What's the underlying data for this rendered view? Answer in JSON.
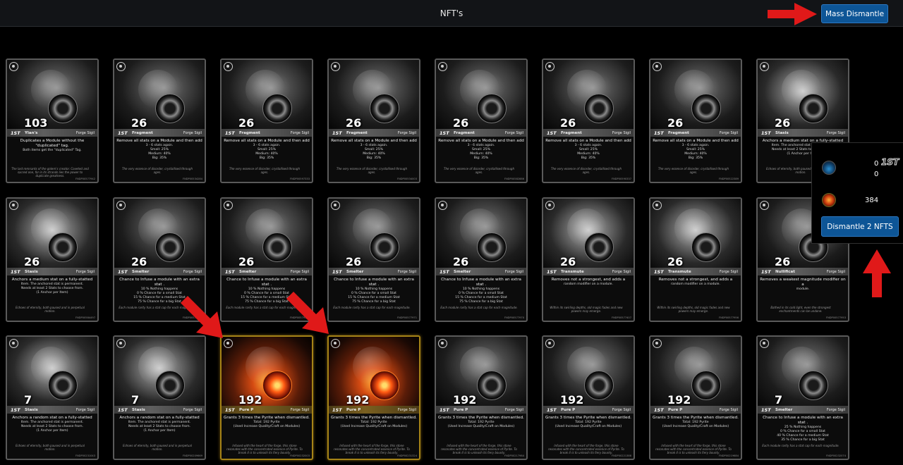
{
  "header": {
    "title": "NFT's",
    "mass_dismantle_label": "Mass Dismantle"
  },
  "side_panel": {
    "st_value": "0",
    "st_tag": "1ST",
    "second_value": "0",
    "pyrite_value": "384",
    "dismantle_label": "Dismantle 2 NFTS"
  },
  "cards": [
    {
      "count": "103",
      "tag": "1ST",
      "name": "Ylan's",
      "kind": "Forge Sigil",
      "art": "gray",
      "selected": false,
      "lines": [
        "Duplicates a Module without the \"duplicated\" tag.",
        "Both items get the \"duplicated\" Tag."
      ],
      "flavor": "The last remnants of the golem's creator. Coveted and sacred one, for in its strands lies the power to duplicate greatness.",
      "serial": "FNDP00577942"
    },
    {
      "count": "26",
      "tag": "1ST",
      "name": "Fragment",
      "kind": "Forge Sigil",
      "art": "gray",
      "selected": false,
      "lines": [
        "Remove all stats on a Module and then add",
        "3 - 6 stats again.",
        "Small: 25%",
        "Medium: 40%",
        "Big: 35%"
      ],
      "flavor": "The very essence of disorder, crystallised through ages.",
      "serial": "FNDP00534284"
    },
    {
      "count": "26",
      "tag": "1ST",
      "name": "Fragment",
      "kind": "Forge Sigil",
      "art": "gray",
      "selected": false,
      "lines": [
        "Remove all stats on a Module and then add",
        "3 - 6 stats again.",
        "Small: 25%",
        "Medium: 40%",
        "Big: 35%"
      ],
      "flavor": "The very essence of disorder, crystallised through ages.",
      "serial": "FNDP00597333"
    },
    {
      "count": "26",
      "tag": "1ST",
      "name": "Fragment",
      "kind": "Forge Sigil",
      "art": "gray",
      "selected": false,
      "lines": [
        "Remove all stats on a Module and then add",
        "3 - 6 stats again.",
        "Small: 25%",
        "Medium: 40%",
        "Big: 35%"
      ],
      "flavor": "The very essence of disorder, crystallised through ages.",
      "serial": "FNDP00534003"
    },
    {
      "count": "26",
      "tag": "1ST",
      "name": "Fragment",
      "kind": "Forge Sigil",
      "art": "gray",
      "selected": false,
      "lines": [
        "Remove all stats on a Module and then add",
        "3 - 6 stats again.",
        "Small: 25%",
        "Medium: 40%",
        "Big: 35%"
      ],
      "flavor": "The very essence of disorder, crystallised through ages.",
      "serial": "FNDP00582886"
    },
    {
      "count": "26",
      "tag": "1ST",
      "name": "Fragment",
      "kind": "Forge Sigil",
      "art": "gray",
      "selected": false,
      "lines": [
        "Remove all stats on a Module and then add",
        "3 - 6 stats again.",
        "Small: 25%",
        "Medium: 40%",
        "Big: 35%"
      ],
      "flavor": "The very essence of disorder, crystallised through ages.",
      "serial": "FNDP00590337"
    },
    {
      "count": "26",
      "tag": "1ST",
      "name": "Fragment",
      "kind": "Forge Sigil",
      "art": "gray",
      "selected": false,
      "lines": [
        "Remove all stats on a Module and then add",
        "3 - 6 stats again.",
        "Small: 25%",
        "Medium: 40%",
        "Big: 35%"
      ],
      "flavor": "The very essence of disorder, crystallised through ages.",
      "serial": "FNDP00522389"
    },
    {
      "count": "26",
      "tag": "1ST",
      "name": "Stasis",
      "kind": "Forge Sigil",
      "art": "gray2",
      "selected": false,
      "lines": [
        "Anchors a medium stat on a fully-statted",
        "Item. The anchored stat is permanent.",
        "Needs at least 2 Stats to choose from.",
        "(1 Anchor per Item)"
      ],
      "flavor": "Echoes of eternity, both paused and in perpetual motion.",
      "serial": "FNDP00591769"
    },
    {
      "count": "26",
      "tag": "1ST",
      "name": "Stasis",
      "kind": "Forge Sigil",
      "art": "gray2",
      "selected": false,
      "lines": [
        "Anchors a medium stat on a fully-statted",
        "Item. The anchored stat is permanent.",
        "Needs at least 2 Stats to choose from.",
        "(1 Anchor per Item)"
      ],
      "flavor": "Echoes of eternity, both paused and in perpetual motion.",
      "serial": "FNDP00584497"
    },
    {
      "count": "26",
      "tag": "1ST",
      "name": "Smelter",
      "kind": "Forge Sigil",
      "art": "gray",
      "selected": false,
      "lines": [
        "Chance to Infuse a module with an extra stat .",
        "10 % Nothing happens",
        "0 % Chance for a small Stat",
        "15 % Chance for a medium Stat",
        "75 % Chance for a big Stat"
      ],
      "flavor": "Each module rarity has a stat cap for each magnitude.",
      "serial": "FNDP00572651"
    },
    {
      "count": "26",
      "tag": "1ST",
      "name": "Smelter",
      "kind": "Forge Sigil",
      "art": "gray",
      "selected": false,
      "lines": [
        "Chance to Infuse a module with an extra stat .",
        "10 % Nothing happens",
        "0 % Chance for a small Stat",
        "15 % Chance for a medium Stat",
        "75 % Chance for a big Stat"
      ],
      "flavor": "Each module rarity has a stat cap for each magnitude.",
      "serial": "FNDP00579108"
    },
    {
      "count": "26",
      "tag": "1ST",
      "name": "Smelter",
      "kind": "Forge Sigil",
      "art": "gray",
      "selected": false,
      "lines": [
        "Chance to Infuse a module with an extra stat .",
        "10 % Nothing happens",
        "0 % Chance for a small Stat",
        "15 % Chance for a medium Stat",
        "75 % Chance for a big Stat"
      ],
      "flavor": "Each module rarity has a stat cap for each magnitude.",
      "serial": "FNDP00577971"
    },
    {
      "count": "26",
      "tag": "1ST",
      "name": "Smelter",
      "kind": "Forge Sigil",
      "art": "gray",
      "selected": false,
      "lines": [
        "Chance to Infuse a module with an extra stat .",
        "10 % Nothing happens",
        "0 % Chance for a small Stat",
        "15 % Chance for a medium Stat",
        "75 % Chance for a big Stat"
      ],
      "flavor": "Each module rarity has a stat cap for each magnitude.",
      "serial": "FNDP00577970"
    },
    {
      "count": "26",
      "tag": "1ST",
      "name": "Transmute",
      "kind": "Forge Sigil",
      "art": "gray2",
      "selected": false,
      "lines": [
        "Removes not a strongest, and adds a",
        "random modifier on a module."
      ],
      "flavor": "Within its swirling depths, old magic fades and new powers may emerge.",
      "serial": "FNDP00577407"
    },
    {
      "count": "26",
      "tag": "1ST",
      "name": "Transmute",
      "kind": "Forge Sigil",
      "art": "gray2",
      "selected": false,
      "lines": [
        "Removes not a strongest, and adds a",
        "random modifier on a module."
      ],
      "flavor": "Within its swirling depths, old magic fades and new powers may emerge.",
      "serial": "FNDP00577956"
    },
    {
      "count": "26",
      "tag": "1ST",
      "name": "Nullificat",
      "kind": "Forge Sigil",
      "art": "gray",
      "selected": false,
      "lines": [
        "Removes a weakest magnitude modifier on a",
        "module."
      ],
      "flavor": "Bathed in its cold light, even the strongest enchantments can be undone.",
      "serial": "FNDP00577953"
    },
    {
      "count": "7",
      "tag": "1ST",
      "name": "Stasis",
      "kind": "Forge Sigil",
      "art": "gray2",
      "selected": false,
      "lines": [
        "Anchors a random stat on a fully-statted",
        "Item. The anchored stat is permanent.",
        "Needs at least 2 Stats to choose from.",
        "(1 Anchor per Item)"
      ],
      "flavor": "Echoes of eternity, both paused and in perpetual motion.",
      "serial": "FNDP00231043"
    },
    {
      "count": "7",
      "tag": "1ST",
      "name": "Stasis",
      "kind": "Forge Sigil",
      "art": "gray2",
      "selected": false,
      "lines": [
        "Anchors a random stat on a fully-statted",
        "Item. The anchored stat is permanent.",
        "Needs at least 2 Stats to choose from.",
        "(1 Anchor per Item)"
      ],
      "flavor": "Echoes of eternity, both paused and in perpetual motion.",
      "serial": "FNDP00209669"
    },
    {
      "count": "192",
      "tag": "1ST",
      "name": "Pure P",
      "kind": "Forge Sigil",
      "art": "fire",
      "selected": true,
      "lines": [
        "Grants 3 times the Pyrite when dismantled.",
        "Total: 192 Pyrite",
        "(Used Increase Quality/Craft on Modules)"
      ],
      "flavor": "Infused with the heart of the forge, this stone resonates with the concentrated essence of Pyrite. To break it is to unleash its fiery bounty.",
      "serial": "FNDP00232003"
    },
    {
      "count": "192",
      "tag": "1ST",
      "name": "Pure P",
      "kind": "Forge Sigil",
      "art": "fire",
      "selected": true,
      "lines": [
        "Grants 3 times the Pyrite when dismantled.",
        "Total: 192 Pyrite",
        "(Used Increase Quality/Craft on Modules)"
      ],
      "flavor": "Infused with the heart of the forge, this stone resonates with the concentrated essence of Pyrite. To break it is to unleash its fiery bounty.",
      "serial": "FNDP00231324"
    },
    {
      "count": "192",
      "tag": "1ST",
      "name": "Pure P",
      "kind": "Forge Sigil",
      "art": "gray",
      "selected": false,
      "lines": [
        "Grants 3 times the Pyrite when dismantled.",
        "Total: 192 Pyrite",
        "(Used Increase Quality/Craft on Modules)"
      ],
      "flavor": "Infused with the heart of the forge, this stone resonates with the concentrated essence of Pyrite. To break it is to unleash its fiery bounty.",
      "serial": "FNDP00217984"
    },
    {
      "count": "192",
      "tag": "1ST",
      "name": "Pure P",
      "kind": "Forge Sigil",
      "art": "gray",
      "selected": false,
      "lines": [
        "Grants 3 times the Pyrite when dismantled.",
        "Total: 192 Pyrite",
        "(Used Increase Quality/Craft on Modules)"
      ],
      "flavor": "Infused with the heart of the forge, this stone resonates with the concentrated essence of Pyrite. To break it is to unleash its fiery bounty.",
      "serial": "FNDP00221388"
    },
    {
      "count": "192",
      "tag": "1ST",
      "name": "Pure P",
      "kind": "Forge Sigil",
      "art": "gray",
      "selected": false,
      "lines": [
        "Grants 3 times the Pyrite when dismantled.",
        "Total: 192 Pyrite",
        "(Used Increase Quality/Craft on Modules)"
      ],
      "flavor": "Infused with the heart of the forge, this stone resonates with the concentrated essence of Pyrite. To break it is to unleash its fiery bounty.",
      "serial": "FNDP00219684"
    },
    {
      "count": "7",
      "tag": "1ST",
      "name": "Smelter",
      "kind": "Forge Sigil",
      "art": "gray",
      "selected": false,
      "lines": [
        "Chance to Infuse a module with an extra stat .",
        "25 % Nothing happens",
        "0 % Chance for a small Stat",
        "40 % Chance for a medium Stat",
        "35 % Chance for a big Stat"
      ],
      "flavor": "Each module rarity has a stat cap for each magnitude.",
      "serial": "FNDP00232074"
    }
  ]
}
